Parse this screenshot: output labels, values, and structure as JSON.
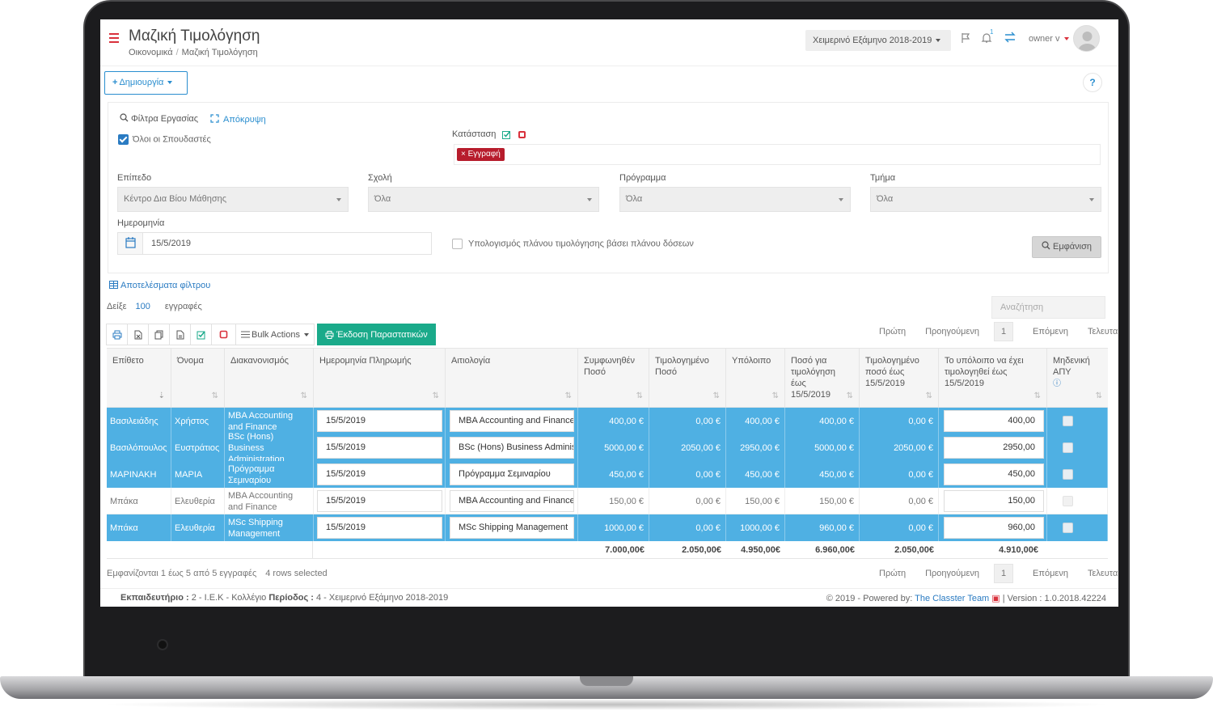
{
  "header": {
    "title": "Μαζική Τιμολόγηση",
    "breadcrumb": [
      "Οικονομικά",
      "Μαζική Τιμολόγηση"
    ],
    "semester": "Χειμερινό Εξάμηνο 2018-2019",
    "notification_count": "1",
    "user": "owner v",
    "icons": {
      "menu": "hamburger-icon",
      "flag": "flag-icon",
      "bell": "bell-icon",
      "swap": "swap-icon"
    },
    "accent_color": "#d9313c"
  },
  "actions": {
    "create_label": "Δημιουργία",
    "help_label": "?"
  },
  "filters": {
    "title": "Φίλτρα Εργασίας",
    "hide_label": "Απόκρυψη",
    "all_students_label": "Όλοι οι Σπουδαστές",
    "all_students_checked": true,
    "status_label": "Κατάσταση",
    "status_tag": "Εγγραφή",
    "level_label": "Επίπεδο",
    "level_value": "Κέντρο Δια Βίου Μάθησης",
    "school_label": "Σχολή",
    "school_value": "Όλα",
    "program_label": "Πρόγραμμα",
    "program_value": "Όλα",
    "department_label": "Τμήμα",
    "department_value": "Όλα",
    "date_label": "Ημερομηνία",
    "date_value": "15/5/2019",
    "plan_label": "Υπολογισμός πλάνου τιμολόγησης βάσει πλάνου δόσεων",
    "plan_checked": false,
    "show_button": "Εμφάνιση"
  },
  "results": {
    "title": "Αποτελέσματα φίλτρου",
    "show_label": "Δείξε",
    "page_size": "100",
    "entries_label": "εγγραφές",
    "search_placeholder": "Αναζήτηση",
    "bulk_actions": "Bulk Actions",
    "issue_button": "Έκδοση Παραστατικών",
    "pager": {
      "first": "Πρώτη",
      "prev": "Προηγούμενη",
      "current": "1",
      "next": "Επόμενη",
      "last": "Τελευταία"
    },
    "columns": [
      "Επίθετο",
      "Όνομα",
      "Διακανονισμός",
      "Ημερομηνία Πληρωμής",
      "Αιτιολογία",
      "Συμφωνηθέν Ποσό",
      "Τιμολογημένο Ποσό",
      "Υπόλοιπο",
      "Ποσό για τιμολόγηση έως 15/5/2019",
      "Τιμολογημένο ποσό έως 15/5/2019",
      "Το υπόλοιπο να έχει τιμολογηθεί έως 15/5/2019",
      "Μηδενική ΑΠΥ"
    ],
    "rows": [
      {
        "selected": true,
        "last": "Βασιλειάδης",
        "first": "Χρήστος",
        "arrangement": "MBA Accounting and Finance",
        "date": "15/5/2019",
        "reason": "MBA Accounting and Finance",
        "agreed": "400,00 €",
        "invoiced": "0,00 €",
        "balance": "400,00 €",
        "to_invoice": "400,00 €",
        "invoiced_until": "0,00 €",
        "remaining": "400,00"
      },
      {
        "selected": true,
        "last": "Βασιλόπουλος",
        "first": "Ευστράτιος",
        "arrangement": "BSc (Hons) Business Administration",
        "date": "15/5/2019",
        "reason": "BSc (Hons) Business Administration",
        "agreed": "5000,00 €",
        "invoiced": "2050,00 €",
        "balance": "2950,00 €",
        "to_invoice": "5000,00 €",
        "invoiced_until": "2050,00 €",
        "remaining": "2950,00"
      },
      {
        "selected": true,
        "last": "ΜΑΡΙΝΑΚΗ",
        "first": "ΜΑΡΙΑ",
        "arrangement": "Πρόγραμμα Σεμιναρίου",
        "date": "15/5/2019",
        "reason": "Πρόγραμμα Σεμιναρίου",
        "agreed": "450,00 €",
        "invoiced": "0,00 €",
        "balance": "450,00 €",
        "to_invoice": "450,00 €",
        "invoiced_until": "0,00 €",
        "remaining": "450,00"
      },
      {
        "selected": false,
        "last": "Μπάκα",
        "first": "Ελευθερία",
        "arrangement": "MBA Accounting and Finance",
        "date": "15/5/2019",
        "reason": "MBA Accounting and Finance",
        "agreed": "150,00 €",
        "invoiced": "0,00 €",
        "balance": "150,00 €",
        "to_invoice": "150,00 €",
        "invoiced_until": "0,00 €",
        "remaining": "150,00"
      },
      {
        "selected": true,
        "last": "Μπάκα",
        "first": "Ελευθερία",
        "arrangement": "MSc Shipping Management",
        "date": "15/5/2019",
        "reason": "MSc Shipping Management",
        "agreed": "1000,00 €",
        "invoiced": "0,00 €",
        "balance": "1000,00 €",
        "to_invoice": "960,00 €",
        "invoiced_until": "0,00 €",
        "remaining": "960,00"
      }
    ],
    "totals": {
      "agreed": "7.000,00€",
      "invoiced": "2.050,00€",
      "balance": "4.950,00€",
      "to_invoice": "6.960,00€",
      "invoiced_until": "2.050,00€",
      "remaining": "4.910,00€"
    },
    "info": "Εμφανίζονται 1 έως 5 από 5 εγγραφές",
    "selected_info": "4 rows selected",
    "selected_color": "#4fb0e3"
  },
  "footer": {
    "institution_label": "Εκπαιδευτήριο :",
    "institution_value": "2 - Ι.Ε.Κ - Κολλέγιο",
    "period_label": "Περίοδος :",
    "period_value": "4 - Χειμερινό Εξάμηνο 2018-2019",
    "copyright": "2019 - Powered by:",
    "team": "The Classter Team",
    "version": "| Version : 1.0.2018.42224"
  }
}
